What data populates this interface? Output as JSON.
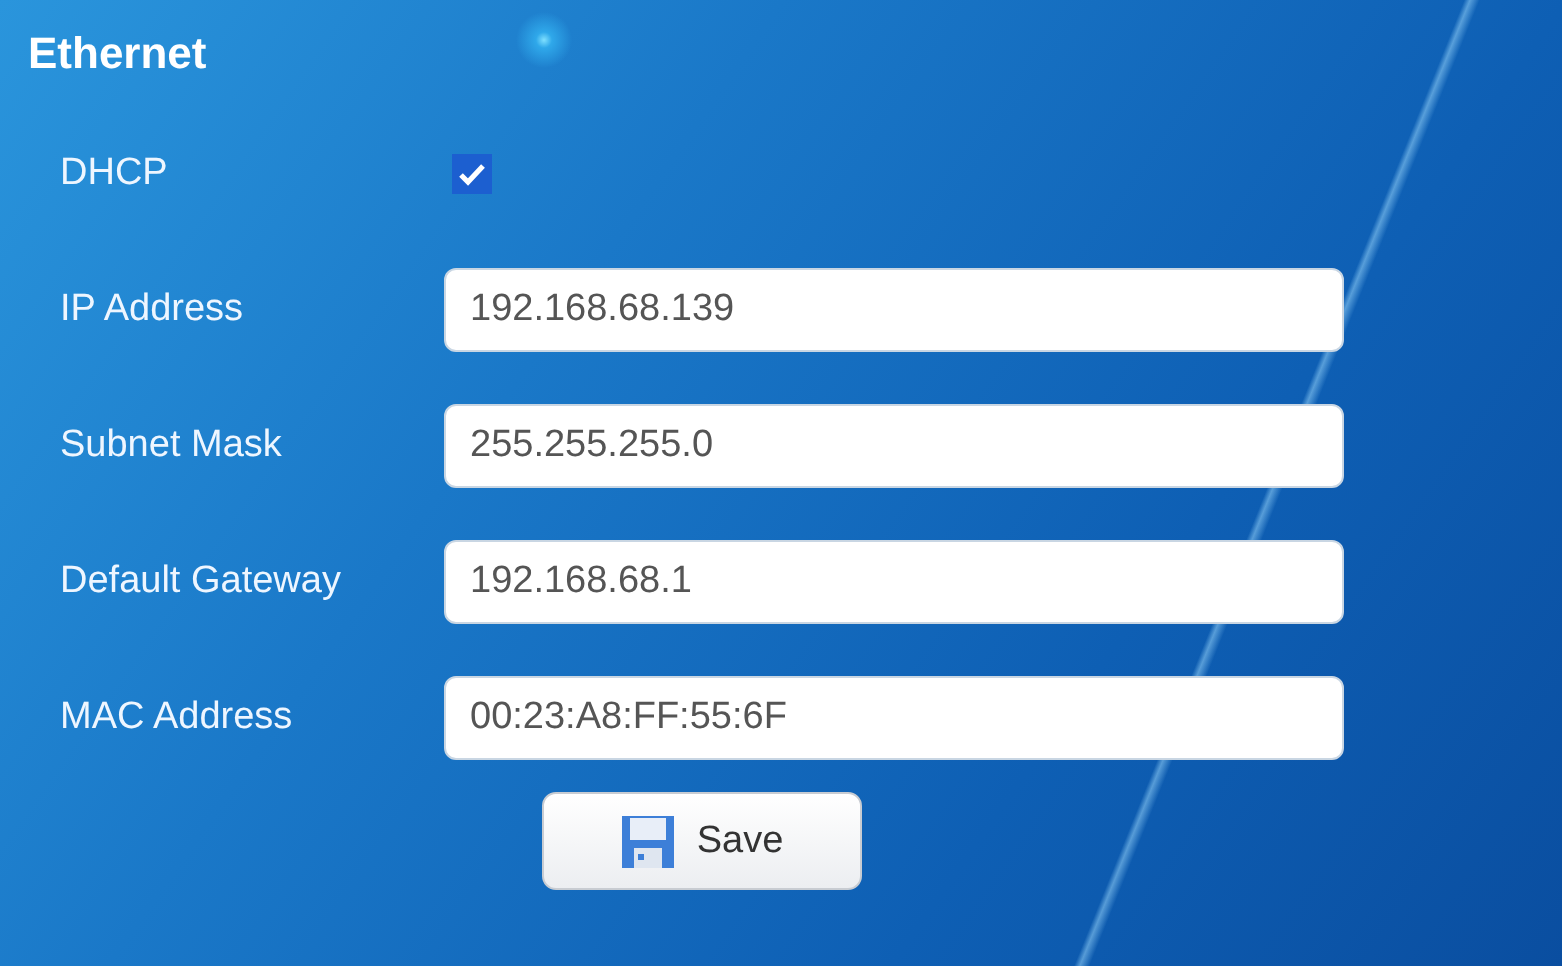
{
  "title": "Ethernet",
  "dhcp": {
    "label": "DHCP",
    "checked": true
  },
  "fields": [
    {
      "label": "IP Address",
      "value": "192.168.68.139"
    },
    {
      "label": "Subnet Mask",
      "value": "255.255.255.0"
    },
    {
      "label": "Default Gateway",
      "value": "192.168.68.1"
    },
    {
      "label": "MAC Address",
      "value": "00:23:A8:FF:55:6F"
    }
  ],
  "save_button": {
    "label": "Save"
  }
}
